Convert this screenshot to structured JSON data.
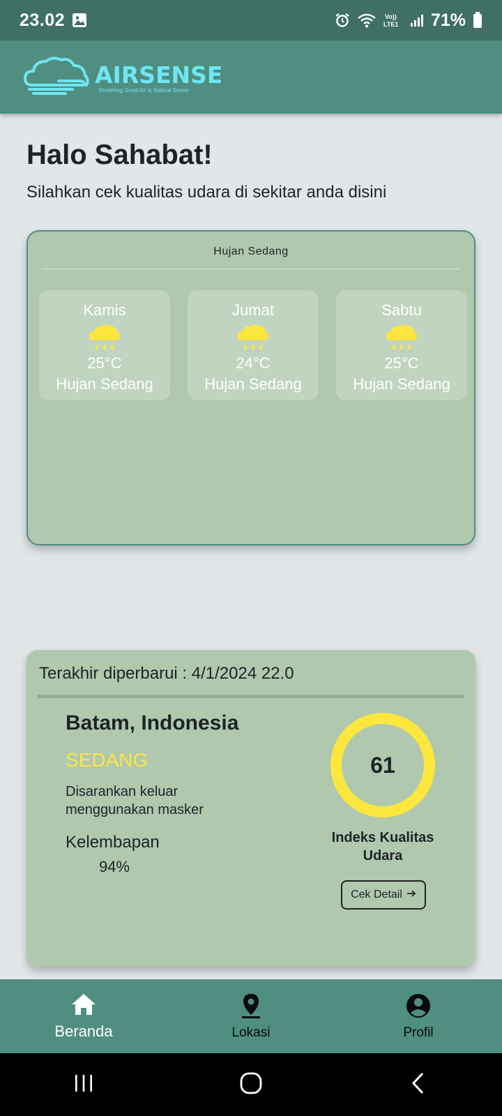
{
  "status_bar": {
    "time": "23.02",
    "network": "Vo)) LTE1",
    "battery": "71%"
  },
  "app_bar": {
    "logo_name": "AIRSENSE",
    "logo_tagline": "Breathing Good Air is Natural Sense"
  },
  "greeting": {
    "title": "Halo Sahabat!",
    "subtitle": "Silahkan cek kualitas udara di sekitar anda disini"
  },
  "weather": {
    "current": "Hujan Sedang",
    "forecast": [
      {
        "day": "Kamis",
        "icon": "rain-cloud-icon",
        "temp": "25°C",
        "condition": "Hujan Sedang"
      },
      {
        "day": "Jumat",
        "icon": "rain-cloud-icon",
        "temp": "24°C",
        "condition": "Hujan Sedang"
      },
      {
        "day": "Sabtu",
        "icon": "rain-cloud-icon",
        "temp": "25°C",
        "condition": "Hujan Sedang"
      }
    ]
  },
  "aqi": {
    "last_updated": "Terakhir diperbarui : 4/1/2024 22.0",
    "city": "Batam, Indonesia",
    "level": "SEDANG",
    "advice": "Disarankan keluar menggunakan masker",
    "humidity_label": "Kelembapan",
    "humidity_value": "94%",
    "index_value": "61",
    "index_label": "Indeks Kualitas Udara",
    "detail_button": "Cek Detail",
    "level_color": "#fde641"
  },
  "bottom_nav": {
    "items": [
      {
        "label": "Beranda",
        "icon": "home-icon",
        "active": true
      },
      {
        "label": "Lokasi",
        "icon": "location-pin-icon",
        "active": false
      },
      {
        "label": "Profil",
        "icon": "profile-icon",
        "active": false
      }
    ]
  },
  "colors": {
    "status_bar": "#3f6f65",
    "app_bar": "#4f8e80",
    "card": "#b0c8ae",
    "background": "#e1e6e9",
    "accent_yellow": "#fde63d",
    "logo": "#6fe6f2"
  }
}
